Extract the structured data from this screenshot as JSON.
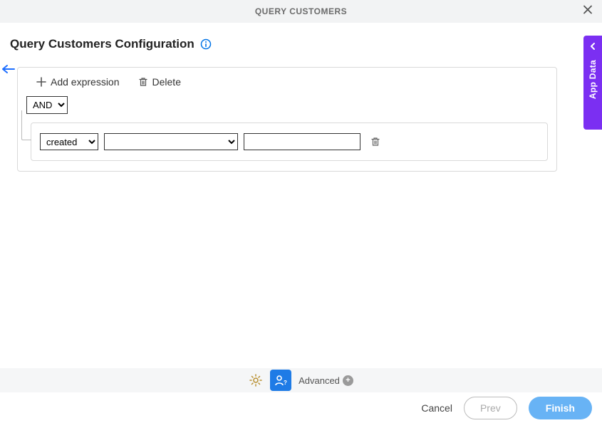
{
  "header": {
    "title": "QUERY CUSTOMERS"
  },
  "page": {
    "title": "Query Customers Configuration"
  },
  "toolbar": {
    "add_label": "Add expression",
    "delete_label": "Delete"
  },
  "logic": {
    "selected": "AND"
  },
  "expression": {
    "field_selected": "created",
    "operator_selected": "",
    "value": ""
  },
  "side_tab": {
    "label": "App Data"
  },
  "footer_toolbar": {
    "advanced_label": "Advanced"
  },
  "buttons": {
    "cancel": "Cancel",
    "prev": "Prev",
    "finish": "Finish"
  }
}
